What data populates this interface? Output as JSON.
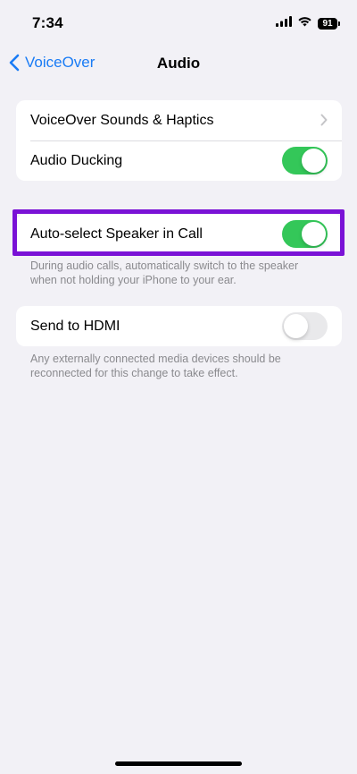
{
  "status": {
    "time": "7:34",
    "battery_level": "91",
    "icons": [
      "cellular-signal-icon",
      "wifi-icon",
      "battery-icon"
    ]
  },
  "nav": {
    "back_label": "VoiceOver",
    "title": "Audio"
  },
  "group1": {
    "rows": [
      {
        "label": "VoiceOver Sounds & Haptics",
        "type": "link"
      },
      {
        "label": "Audio Ducking",
        "type": "toggle",
        "on": true
      }
    ]
  },
  "group2": {
    "row": {
      "label": "Auto-select Speaker in Call",
      "type": "toggle",
      "on": true
    },
    "footnote": "During audio calls, automatically switch to the speaker when not holding your iPhone to your ear."
  },
  "group3": {
    "row": {
      "label": "Send to HDMI",
      "type": "toggle",
      "on": false
    },
    "footnote": "Any externally connected media devices should be reconnected for this change to take effect."
  },
  "colors": {
    "accent": "#1a7cf5",
    "toggle_on": "#34c759",
    "toggle_off": "#e9e9eb",
    "highlight": "#7a12d6",
    "background": "#f2f1f6"
  }
}
